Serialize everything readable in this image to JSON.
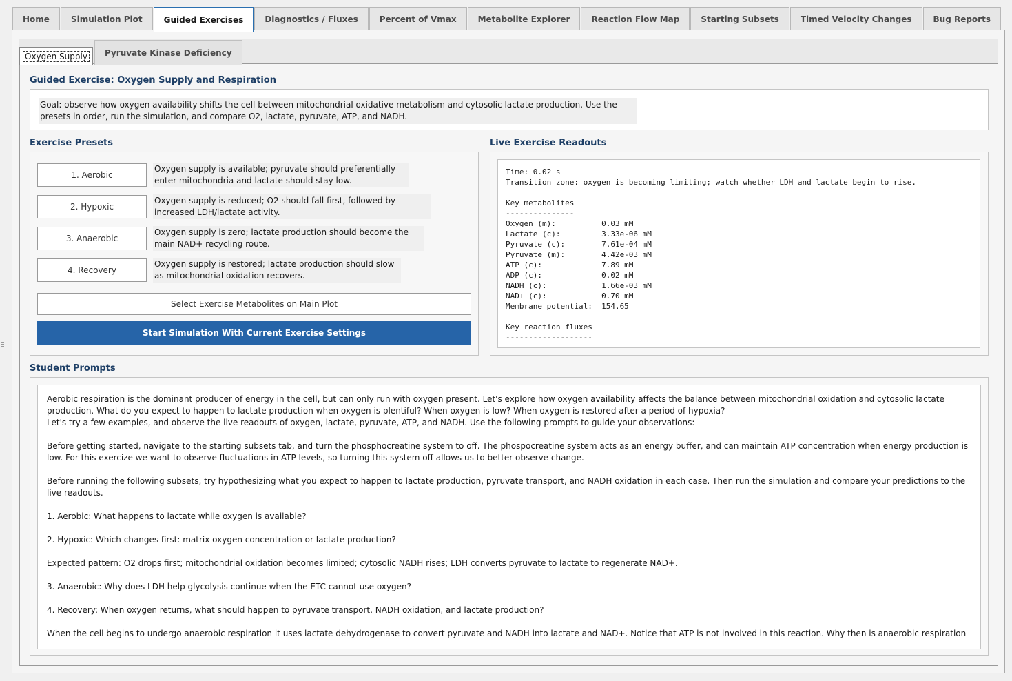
{
  "top_tabs": [
    {
      "label": "Home"
    },
    {
      "label": "Simulation Plot"
    },
    {
      "label": "Guided Exercises"
    },
    {
      "label": "Diagnostics / Fluxes"
    },
    {
      "label": "Percent of Vmax"
    },
    {
      "label": "Metabolite Explorer"
    },
    {
      "label": "Reaction Flow Map"
    },
    {
      "label": "Starting Subsets"
    },
    {
      "label": "Timed Velocity Changes"
    },
    {
      "label": "Bug Reports"
    }
  ],
  "sub_tabs": [
    {
      "label": "Oxygen Supply"
    },
    {
      "label": "Pyruvate Kinase Deficiency"
    }
  ],
  "exercise": {
    "title": "Guided Exercise: Oxygen Supply and Respiration",
    "goal": "Goal: observe how oxygen availability shifts the cell between mitochondrial oxidative metabolism and cytosolic lactate production. Use the presets in order, run the simulation, and compare O2, lactate, pyruvate, ATP, and NADH."
  },
  "presets": {
    "heading": "Exercise Presets",
    "items": [
      {
        "label": "1. Aerobic",
        "desc": "Oxygen supply is available; pyruvate should preferentially enter mitochondria and lactate should stay low."
      },
      {
        "label": "2. Hypoxic",
        "desc": "Oxygen supply is reduced; O2 should fall first, followed by increased LDH/lactate activity."
      },
      {
        "label": "3. Anaerobic",
        "desc": "Oxygen supply is zero; lactate production should become the main NAD+ recycling route."
      },
      {
        "label": "4. Recovery",
        "desc": "Oxygen supply is restored; lactate production should slow as mitochondrial oxidation recovers."
      }
    ],
    "select_button": "Select Exercise Metabolites on Main Plot",
    "start_button": "Start Simulation With Current Exercise Settings"
  },
  "readouts": {
    "heading": "Live Exercise Readouts",
    "text": "Time: 0.02 s\nTransition zone: oxygen is becoming limiting; watch whether LDH and lactate begin to rise.\n\nKey metabolites\n---------------\nOxygen (m):          0.03 mM\nLactate (c):         3.33e-06 mM\nPyruvate (c):        7.61e-04 mM\nPyruvate (m):        4.42e-03 mM\nATP (c):             7.89 mM\nADP (c):             0.02 mM\nNADH (c):            1.66e-03 mM\nNAD+ (c):            0.70 mM\nMembrane potential:  154.65\n\nKey reaction fluxes\n-------------------"
  },
  "prompts": {
    "heading": "Student Prompts",
    "intro_1": "Aerobic respiration is the dominant producer of energy in the cell, but can only run with oxygen present. Let's explore how oxygen availability affects the balance between mitochondrial oxidation and cytosolic lactate production. What do you expect to happen to lactate production when oxygen is plentiful? When oxygen is low? When oxygen is restored after a period of hypoxia?",
    "intro_2": "Let's try a few examples, and observe the live readouts of oxygen, lactate, pyruvate, ATP, and NADH. Use the following prompts to guide your observations:",
    "setup": "Before getting started, navigate to the starting subsets tab, and turn the phosphocreatine system to off. The phospocreatine system acts as an energy buffer, and can maintain ATP concentration when energy production is low. For this exercize we want to observe fluctuations in ATP levels, so turning this system off allows us to better observe change.",
    "hypothesis": "Before running the following subsets, try hypothesizing what you expect to happen to lactate production, pyruvate transport, and NADH oxidation in each case. Then run the simulation and compare your predictions to the live readouts.",
    "q1": "1. Aerobic: What happens to lactate while oxygen is available?",
    "q2": "2. Hypoxic: Which changes first: matrix oxygen concentration or lactate production?",
    "expected": "Expected pattern: O2 drops first; mitochondrial oxidation becomes limited; cytosolic NADH rises; LDH converts pyruvate to lactate to regenerate NAD+.",
    "q3": "3. Anaerobic: Why does LDH help glycolysis continue when the ETC cannot use oxygen?",
    "q4": "4. Recovery: When oxygen returns, what should happen to pyruvate transport, NADH oxidation, and lactate production?",
    "closing": "When the cell begins to undergo anaerobic respiration it uses lactate dehydrogenase to convert pyruvate and NADH into lactate and NAD+. Notice that ATP is not involved in this reaction. Why then is anaerobic respiration"
  },
  "colors": {
    "accent": "#2664a8",
    "heading": "#1e3f66"
  }
}
